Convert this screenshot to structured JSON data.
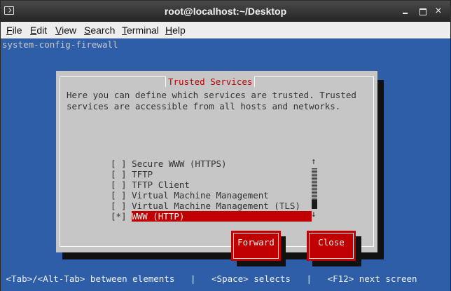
{
  "window": {
    "title": "root@localhost:~/Desktop",
    "minimize": "minimize",
    "maximize": "maximize",
    "close": "×"
  },
  "menu": [
    "File",
    "Edit",
    "View",
    "Search",
    "Terminal",
    "Help"
  ],
  "terminal": {
    "program": "system-config-firewall",
    "dialog": {
      "title": "Trusted Services",
      "description_line1": "Here you can define which services are trusted. Trusted",
      "description_line2": "services are accessible from all hosts and networks.",
      "services": [
        {
          "checkbox": "[ ]",
          "label": "Secure WWW (HTTPS)"
        },
        {
          "checkbox": "[ ]",
          "label": "TFTP"
        },
        {
          "checkbox": "[ ]",
          "label": "TFTP Client"
        },
        {
          "checkbox": "[ ]",
          "label": "Virtual Machine Management"
        },
        {
          "checkbox": "[ ]",
          "label": "Virtual Machine Management (TLS)"
        },
        {
          "checkbox": "[*]",
          "label": "WWW (HTTP)"
        }
      ],
      "scroll_up": "↑",
      "scroll_down": "↓",
      "forward_label": "Forward",
      "close_label": "Close"
    },
    "help_line": " <Tab>/<Alt-Tab> between elements   |   <Space> selects   |   <F12> next screen"
  },
  "colors": {
    "terminal_bg": "#2e5ea8",
    "dialog_bg": "#c6c6c6",
    "accent_red": "#c00000"
  }
}
